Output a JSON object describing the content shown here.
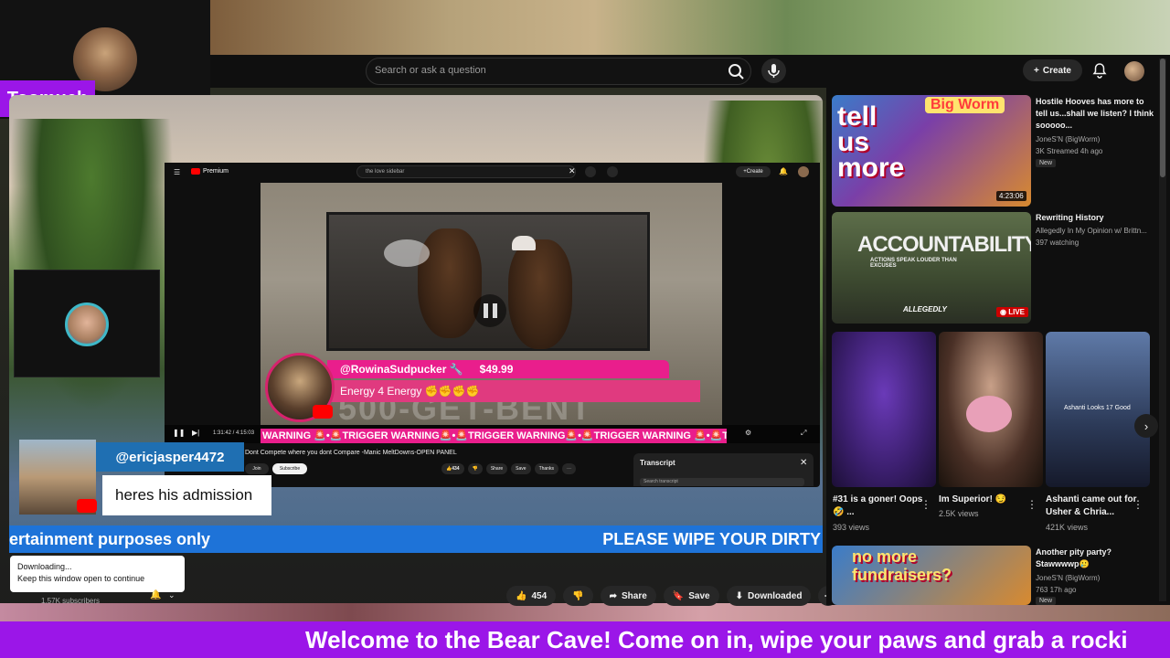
{
  "overlay": {
    "streamer_name": "Toomuch",
    "welcome_ticker": "Welcome to the Bear Cave! Come on in, wipe your paws and grab a rocki",
    "blue_ticker_left": "ertainment purposes only",
    "blue_ticker_right": "PLEASE WIPE YOUR DIRTY",
    "chat": {
      "username": "@ericjasper4472",
      "message": "heres his admission"
    },
    "superchat": {
      "username": "@RowinaSudpucker 🔧",
      "amount": "$49.99",
      "message": "Energy 4 Energy ✊✊✊✊",
      "big_text": "500-GET-BENT"
    },
    "trigger_ticker": "WARNING 🚨•🚨TRIGGER WARNING🚨•🚨TRIGGER WARNING🚨•🚨TRIGGER WARNING 🚨•🚨T"
  },
  "header": {
    "search_placeholder": "Search or ask a question",
    "create_label": "Create"
  },
  "inner_page": {
    "logo": "Premium",
    "search_text": "the love sidebar",
    "create_label": "Create",
    "time": "1:31:42 / 4:15:03",
    "video_title": "Dont Compete where you dont Compare -Manic MeltDowns-OPEN PANEL",
    "join_label": "Join",
    "subscribe_label": "Subscribe",
    "likes": "434",
    "share_label": "Share",
    "save_label": "Save",
    "thanks_label": "Thanks",
    "transcript_title": "Transcript",
    "transcript_search": "Search transcript"
  },
  "downloading": {
    "line1": "Downloading...",
    "line2": "Keep this window open to continue"
  },
  "channel": {
    "subscribers": "1.57K subscribers"
  },
  "actions": {
    "likes": "454",
    "share": "Share",
    "save": "Save",
    "downloaded": "Downloaded"
  },
  "sidebar": {
    "videos": [
      {
        "title": "Hostile Hooves has more to tell us...shall we listen? I think sooooo...",
        "channel": "JoneS'N (BigWorm)",
        "stats": "3K  Streamed 4h ago",
        "badge": "New",
        "duration": "4:23:06",
        "thumb_text_1": "tell us more",
        "thumb_text_2": "Big Worm"
      },
      {
        "title": "Rewriting History",
        "channel": "Allegedly In My Opinion w/ Brittn...",
        "stats": "397 watching",
        "live": "LIVE",
        "thumb_text_1": "ACCOUNTABILITY",
        "thumb_text_2": "ACTIONS SPEAK LOUDER THAN EXCUSES",
        "thumb_text_3": "ALLEGEDLY"
      },
      {
        "title": "Another pity party? Stawwwwp🥲",
        "channel": "JoneS'N (BigWorm)",
        "stats": "763  17h ago",
        "badge": "New",
        "thumb_text_1": "no more fundraisers?"
      }
    ],
    "shorts": [
      {
        "title": "#31 is a goner! Oops 🤣 ...",
        "views": "393 views"
      },
      {
        "title": "Im Superior! 😏",
        "views": "2.5K views"
      },
      {
        "title": "Ashanti came out for Usher & Chria...",
        "views": "421K views",
        "thumb_caption": "Ashanti Looks 17 Good"
      }
    ]
  },
  "colors": {
    "purple": "#9b16e8",
    "pink": "#e91e8c",
    "blue": "#1e73d8",
    "youtube_red": "#ff0000"
  }
}
